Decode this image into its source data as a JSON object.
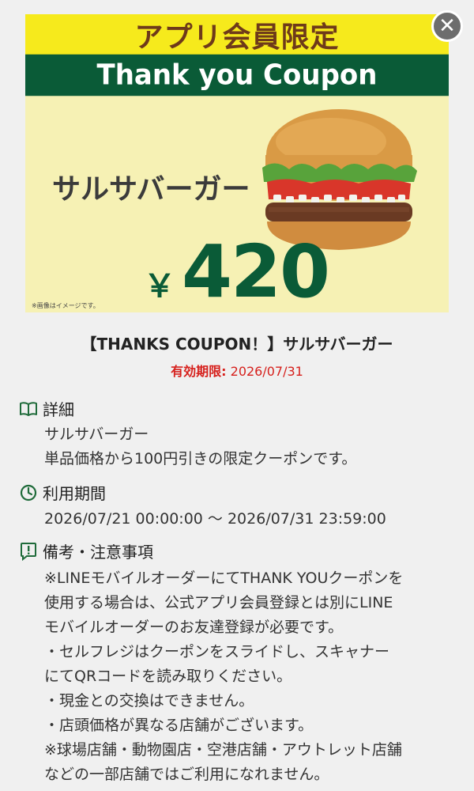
{
  "banner": {
    "top_text": "アプリ会員限定",
    "band_text": "Thank you Coupon",
    "product": "サルサバーガー",
    "currency": "￥",
    "price": "420",
    "disclaimer": "※画像はイメージです。",
    "colors": {
      "yellow": "#f6ea1c",
      "green": "#0a5b37",
      "cream": "#f6f1b4"
    }
  },
  "close": {
    "glyph": "✕",
    "icon": "close-icon"
  },
  "coupon": {
    "title": "【THANKS COUPON！】サルサバーガー",
    "expiry_label": "有効期限:",
    "expiry_value": " 2026/07/31"
  },
  "details": {
    "heading": "詳細",
    "icon": "book-icon",
    "line1": "サルサバーガー",
    "line2": "単品価格から100円引きの限定クーポンです。"
  },
  "period": {
    "heading": "利用期間",
    "icon": "clock-icon",
    "value": "2026/07/21 00:00:00 〜 2026/07/31 23:59:00"
  },
  "notes": {
    "heading": "備考・注意事項",
    "icon": "alert-icon",
    "lines": [
      "※LINEモバイルオーダーにてTHANK YOUクーポンを",
      "使用する場合は、公式アプリ会員登録とは別にLINE",
      "モバイルオーダーのお友達登録が必要です。",
      "・セルフレジはクーポンをスライドし、スキャナー",
      "にてQRコードを読み取りください。",
      "・現金との交換はできません。",
      "・店頭価格が異なる店舗がございます。",
      "※球場店舗・動物園店・空港店舗・アウトレット店舗",
      "などの一部店舗ではご利用になれません。"
    ]
  }
}
